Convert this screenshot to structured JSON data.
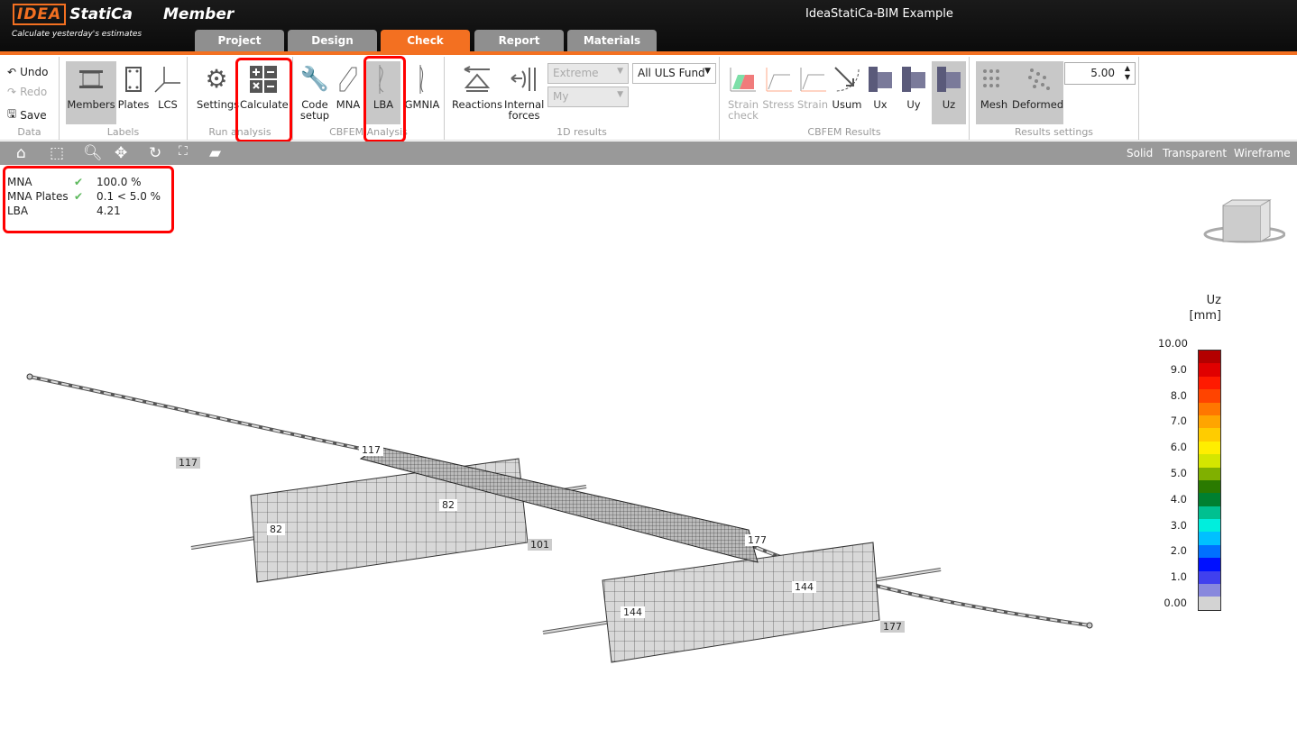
{
  "app": {
    "logo_brand": "IDEA StatiCa",
    "name": "Member",
    "slogan": "Calculate yesterday's estimates",
    "window_title": "IdeaStatiCa-BIM Example"
  },
  "tabs": [
    {
      "label": "Project"
    },
    {
      "label": "Design"
    },
    {
      "label": "Check",
      "active": true
    },
    {
      "label": "Report"
    },
    {
      "label": "Materials"
    }
  ],
  "ribbon": {
    "data": {
      "label": "Data",
      "undo": "Undo",
      "redo": "Redo",
      "save": "Save"
    },
    "labels": {
      "label": "Labels",
      "members": "Members",
      "plates": "Plates",
      "lcs": "LCS"
    },
    "run": {
      "label": "Run analysis",
      "settings": "Settings",
      "calculate": "Calculate"
    },
    "cbfem": {
      "label": "CBFEM Analysis",
      "code_setup": "Code setup",
      "mna": "MNA",
      "lba": "LBA",
      "gmnia": "GMNIA"
    },
    "results1d": {
      "label": "1D results",
      "reactions": "Reactions",
      "internal_forces": "Internal forces",
      "extreme": "Extreme",
      "my": "My",
      "combination": "All ULS Fund"
    },
    "cbfem_results": {
      "label": "CBFEM Results",
      "strain_check": "Strain check",
      "stress": "Stress",
      "strain": "Strain",
      "usum": "Usum",
      "ux": "Ux",
      "uy": "Uy",
      "uz": "Uz"
    },
    "settings": {
      "label": "Results settings",
      "mesh": "Mesh",
      "deformed": "Deformed",
      "scale": "5.00"
    }
  },
  "views": {
    "solid": "Solid",
    "transparent": "Transparent",
    "wireframe": "Wireframe"
  },
  "status": [
    {
      "name": "MNA",
      "ok": true,
      "value": "100.0 %"
    },
    {
      "name": "MNA Plates",
      "ok": true,
      "value": "0.1 < 5.0 %"
    },
    {
      "name": "LBA",
      "ok": false,
      "value": "4.21"
    }
  ],
  "legend": {
    "title": "Uz",
    "unit": "[mm]",
    "ticks": [
      "10.00",
      "9.0",
      "8.0",
      "7.0",
      "6.0",
      "5.0",
      "4.0",
      "3.0",
      "2.0",
      "1.0",
      "0.00"
    ],
    "colors": [
      "#b30000",
      "#e00000",
      "#ff1a00",
      "#ff4400",
      "#ff7700",
      "#ffa500",
      "#ffcc00",
      "#ffee00",
      "#d4e600",
      "#80b000",
      "#2a7a00",
      "#008030",
      "#00c090",
      "#00eedd",
      "#00c0ff",
      "#0070ff",
      "#0010ff",
      "#4040ee",
      "#8888dd",
      "#d3d3d3"
    ]
  },
  "node_labels": [
    "117",
    "117",
    "82",
    "82",
    "101",
    "177",
    "144",
    "144",
    "177"
  ],
  "colors": {
    "accent": "#f37021"
  }
}
